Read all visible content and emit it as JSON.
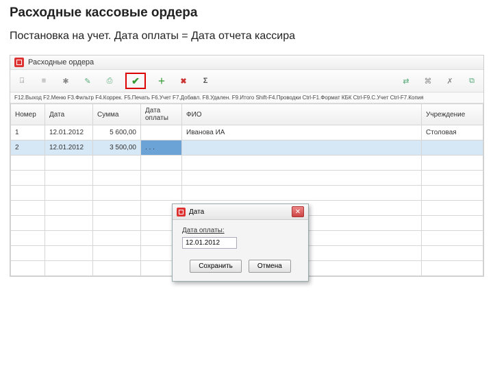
{
  "page": {
    "title": "Расходные кассовые ордера",
    "subtitle": "Постановка на учет. Дата оплаты = Дата отчета кассира"
  },
  "window": {
    "title": "Расходные ордера"
  },
  "hints": "F12.Выход F2.Меню F3.Фильтр F4.Коррек. F5.Печать F6.Учет F7.Добавл. F8.Удален. F9.Итого Shift-F4.Проводки Ctrl-F1.Формат КБК Ctrl-F9.С.Учет Ctrl-F7.Копия",
  "columns": {
    "number": "Номер",
    "date": "Дата",
    "sum": "Сумма",
    "payDate": "Дата оплаты",
    "fio": "ФИО",
    "institution": "Учреждение"
  },
  "rows": [
    {
      "n": "1",
      "date": "12.01.2012",
      "sum": "5 600,00",
      "payDate": "",
      "fio": "Иванова ИА",
      "inst": "Столовая"
    },
    {
      "n": "2",
      "date": "12.01.2012",
      "sum": "3 500,00",
      "payDate": ". . .",
      "fio": "",
      "inst": ""
    }
  ],
  "dialog": {
    "title": "Дата",
    "label": "Дата оплаты:",
    "value": "12.01.2012",
    "save": "Сохранить",
    "cancel": "Отмена"
  }
}
